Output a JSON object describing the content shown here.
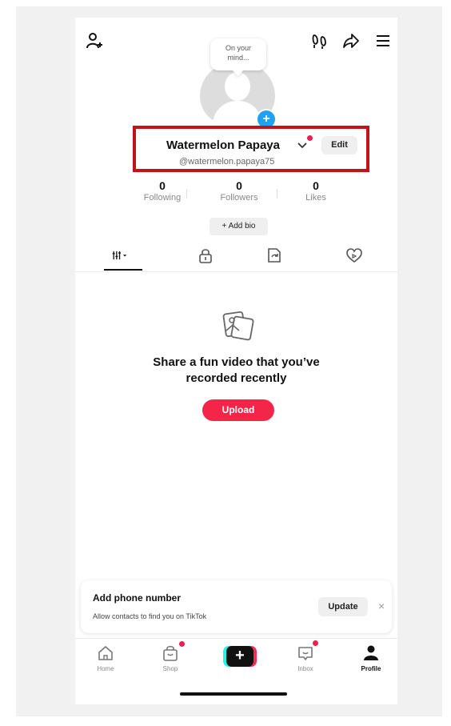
{
  "header": {
    "bubble_text_line1": "On your",
    "bubble_text_line2": "mind..."
  },
  "profile": {
    "display_name": "Watermelon Papaya",
    "username": "@watermelon.papaya75",
    "edit_label": "Edit",
    "add_bio_label": "+ Add bio"
  },
  "stats": [
    {
      "value": "0",
      "label": "Following"
    },
    {
      "value": "0",
      "label": "Followers"
    },
    {
      "value": "0",
      "label": "Likes"
    }
  ],
  "empty_state": {
    "title_line1": "Share a fun video that you’ve",
    "title_line2": "recorded recently",
    "upload_label": "Upload"
  },
  "phone_prompt": {
    "title": "Add phone number",
    "subtitle": "Allow contacts to find you on TikTok",
    "update_label": "Update",
    "close_glyph": "×"
  },
  "nav": {
    "home": "Home",
    "shop": "Shop",
    "create": "+",
    "inbox": "Inbox",
    "profile": "Profile"
  },
  "colors": {
    "accent": "#f3264a",
    "highlight_border": "#c2121c",
    "avatar_badge": "#1fa2f0",
    "notification_dot": "#ee1d52"
  }
}
